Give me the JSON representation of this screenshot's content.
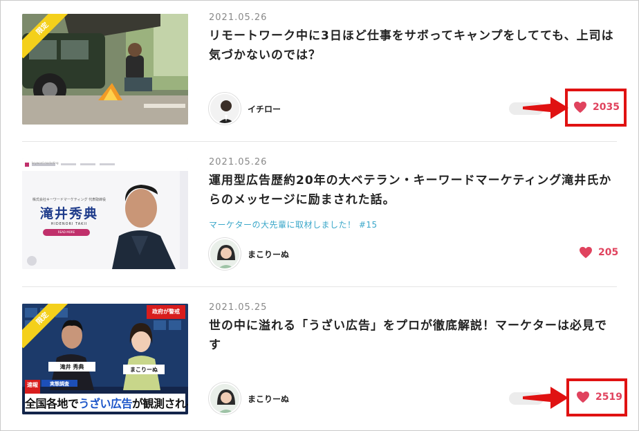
{
  "articles": [
    {
      "date": "2021.05.26",
      "title": "リモートワーク中に3日ほど仕事をサボってキャンプをしてても、上司は気づかないのでは？",
      "badge": "限定",
      "author": "イチロー",
      "likes": "2035",
      "highlighted": true
    },
    {
      "date": "2021.05.26",
      "title": "運用型広告歴約20年の大ベテラン・キーワードマーケティング滝井氏からのメッセージに励まされた話。",
      "series": "マーケターの大先輩に取材しました！ #15",
      "thumb_name": "滝井秀典",
      "thumb_name_romaji": "HIDENORI TAKII",
      "thumb_sub": "株式会社キーワードマーケティング 代表取締役",
      "thumb_button": "READ MORE",
      "thumb_logo": "keyword marketing",
      "author": "まこりーぬ",
      "likes": "205",
      "highlighted": false
    },
    {
      "date": "2021.05.25",
      "title": "世の中に溢れる「うざい広告」をプロが徹底解説！マーケターは必見です",
      "badge": "限定",
      "thumb_caption_small": "実態調査",
      "thumb_caption_prefix": "全国各地で",
      "thumb_caption_keyword": "うざい広告",
      "thumb_caption_suffix": "が観測される",
      "thumb_breaking": "速報",
      "thumb_person1": "滝井 秀典",
      "thumb_person2": "まこりーぬ",
      "thumb_corner": "政府が警戒",
      "author": "まこりーぬ",
      "likes": "2519",
      "highlighted": true
    }
  ],
  "colors": {
    "accent_like": "#e0435e",
    "highlight": "#e01212",
    "series_link": "#3aa7c9",
    "ribbon": "#f4d01b"
  }
}
